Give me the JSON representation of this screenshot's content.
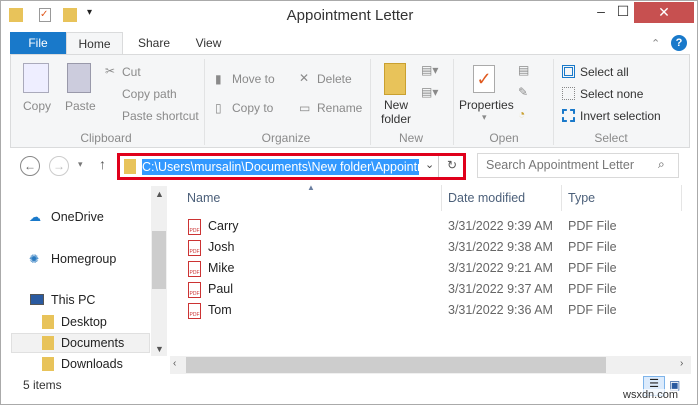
{
  "window": {
    "title": "Appointment Letter",
    "minimize": "–",
    "maximize": "☐",
    "close": "✕"
  },
  "tabs": [
    {
      "label": "File"
    },
    {
      "label": "Home"
    },
    {
      "label": "Share"
    },
    {
      "label": "View"
    }
  ],
  "ribbon": {
    "clipboard": {
      "copy": "Copy",
      "paste": "Paste",
      "cut": "Cut",
      "copy_path": "Copy path",
      "paste_shortcut": "Paste shortcut",
      "group": "Clipboard"
    },
    "organize": {
      "move_to": "Move to",
      "copy_to": "Copy to",
      "delete": "Delete",
      "rename": "Rename",
      "group": "Organize"
    },
    "new": {
      "new_folder": "New folder",
      "group": "New"
    },
    "open": {
      "properties": "Properties",
      "group": "Open"
    },
    "select": {
      "select_all": "Select all",
      "select_none": "Select none",
      "invert": "Invert selection",
      "group": "Select"
    }
  },
  "address": {
    "path": "C:\\Users\\mursalin\\Documents\\New folder\\Appointment Letter",
    "search_placeholder": "Search Appointment Letter"
  },
  "nav": [
    {
      "label": "OneDrive"
    },
    {
      "label": "Homegroup"
    },
    {
      "label": "This PC"
    },
    {
      "label": "Desktop"
    },
    {
      "label": "Documents"
    },
    {
      "label": "Downloads"
    }
  ],
  "columns": {
    "name": "Name",
    "date": "Date modified",
    "type": "Type"
  },
  "files": [
    {
      "name": "Carry",
      "date": "3/31/2022 9:39 AM",
      "type": "PDF File"
    },
    {
      "name": "Josh",
      "date": "3/31/2022 9:38 AM",
      "type": "PDF File"
    },
    {
      "name": "Mike",
      "date": "3/31/2022 9:21 AM",
      "type": "PDF File"
    },
    {
      "name": "Paul",
      "date": "3/31/2022 9:37 AM",
      "type": "PDF File"
    },
    {
      "name": "Tom",
      "date": "3/31/2022 9:36 AM",
      "type": "PDF File"
    }
  ],
  "status": {
    "count": "5 items"
  },
  "watermark": "wsxdn.com"
}
